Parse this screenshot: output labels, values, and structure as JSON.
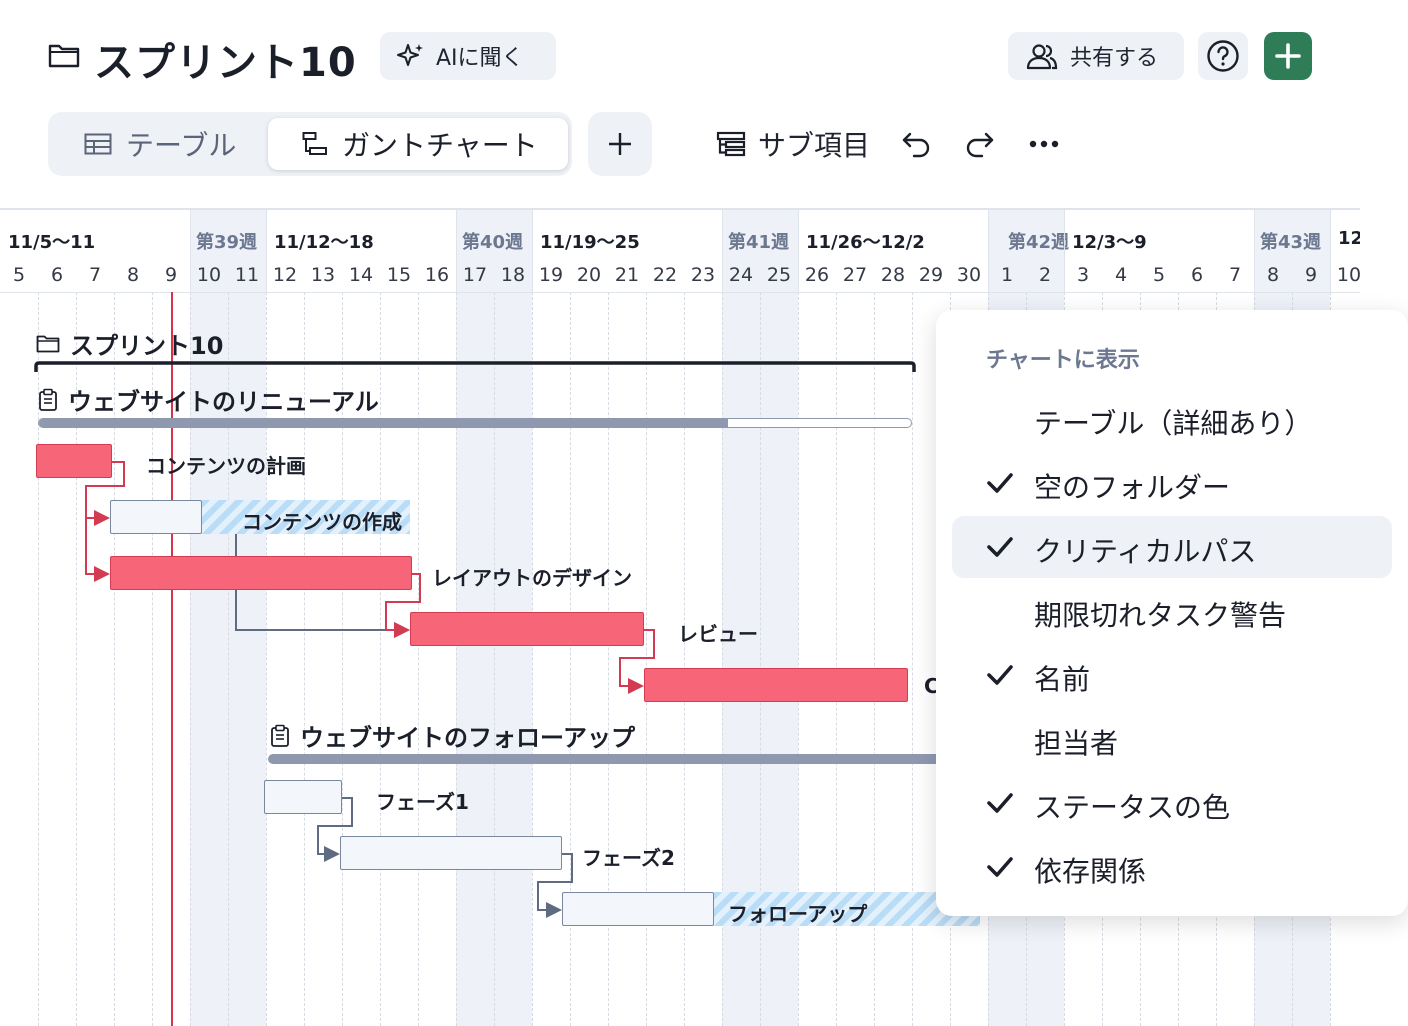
{
  "header": {
    "title": "スプリント10",
    "ai_button": "AIに聞く",
    "share_button": "共有する",
    "help_icon": "help-icon",
    "add_icon": "plus-icon",
    "colors": {
      "add_button": "#2e7d57",
      "critical": "#f76578"
    }
  },
  "toolbar": {
    "tabs": [
      {
        "label": "テーブル"
      },
      {
        "label": "ガントチャート"
      }
    ],
    "active_tab": "ガントチャート",
    "subitems_label": "サブ項目"
  },
  "timeline": {
    "weeks": [
      {
        "range": "11/5〜11",
        "num": ""
      },
      {
        "range": "",
        "num": "第39週"
      },
      {
        "range": "11/12〜18",
        "num": ""
      },
      {
        "range": "",
        "num": "第40週"
      },
      {
        "range": "11/19〜25",
        "num": ""
      },
      {
        "range": "",
        "num": "第41週"
      },
      {
        "range": "11/26〜12/2",
        "num": ""
      },
      {
        "range": "",
        "num": "第42週"
      },
      {
        "range": "12/3〜9",
        "num": ""
      },
      {
        "range": "",
        "num": "第43週"
      },
      {
        "range": "12",
        "num": ""
      }
    ],
    "days": [
      "5",
      "6",
      "7",
      "8",
      "9",
      "10",
      "11",
      "12",
      "13",
      "14",
      "15",
      "16",
      "17",
      "18",
      "19",
      "20",
      "21",
      "22",
      "23",
      "24",
      "25",
      "26",
      "27",
      "28",
      "29",
      "30",
      "1",
      "2",
      "3",
      "4",
      "5",
      "6",
      "7",
      "8",
      "9",
      "10"
    ]
  },
  "gantt": {
    "folder": "スプリント10",
    "groups": [
      {
        "name": "ウェブサイトのリニューアル",
        "progress": 0.79
      },
      {
        "name": "ウェブサイトのフォローアップ"
      }
    ],
    "tasks": [
      "コンテンツの計画",
      "コンテンツの作成",
      "レイアウトのデザイン",
      "レビュー",
      "C",
      "フェーズ1",
      "フェーズ2",
      "フォローアップ"
    ]
  },
  "menu": {
    "heading": "チャートに表示",
    "items": [
      {
        "label": "テーブル（詳細あり）",
        "checked": false
      },
      {
        "label": "空のフォルダー",
        "checked": true
      },
      {
        "label": "クリティカルパス",
        "checked": true
      },
      {
        "label": "期限切れタスク警告",
        "checked": false
      },
      {
        "label": "名前",
        "checked": true
      },
      {
        "label": "担当者",
        "checked": false
      },
      {
        "label": "ステータスの色",
        "checked": true
      },
      {
        "label": "依存関係",
        "checked": true
      }
    ]
  }
}
